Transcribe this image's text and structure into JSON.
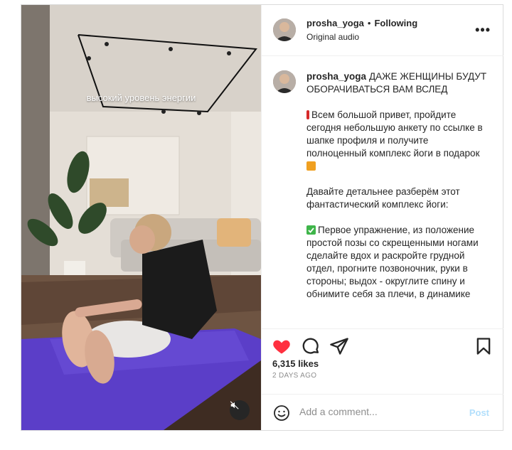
{
  "media": {
    "overlay_text": "высокий уровень энергии",
    "mute_icon": "speaker-muted-icon"
  },
  "header": {
    "username": "prosha_yoga",
    "separator": "•",
    "follow_status": "Following",
    "audio": "Original audio",
    "more_icon": "more-horizontal-icon",
    "more_label": "•••"
  },
  "caption": {
    "username": "prosha_yoga",
    "title": "ДАЖЕ ЖЕНЩИНЫ БУДУТ ОБОРАЧИВАТЬСЯ ВАМ ВСЛЕД",
    "paragraph1": "Всем большой привет, пройдите сегодня небольшую анкету по ссылке в шапке профиля и получите полноценный комплекс йоги в подарок",
    "paragraph2": "Давайте детальнее разберём этот фантастический комплекс йоги:",
    "paragraph3": "Первое упражнение, из положение простой позы со скрещенными ногами сделайте вдох и раскройте грудной отдел, прогните позвоночник, руки в стороны; выдох - округлите спину и обнимите себя за плечи, в динамике"
  },
  "actions": {
    "like_icon": "heart-filled-icon",
    "comment_icon": "comment-icon",
    "share_icon": "share-icon",
    "save_icon": "bookmark-icon",
    "like_color": "#ff3040"
  },
  "stats": {
    "likes": "6,315 likes",
    "time_ago": "2 DAYS AGO"
  },
  "comment": {
    "emoji_icon": "emoji-icon",
    "placeholder": "Add a comment...",
    "post_label": "Post"
  }
}
